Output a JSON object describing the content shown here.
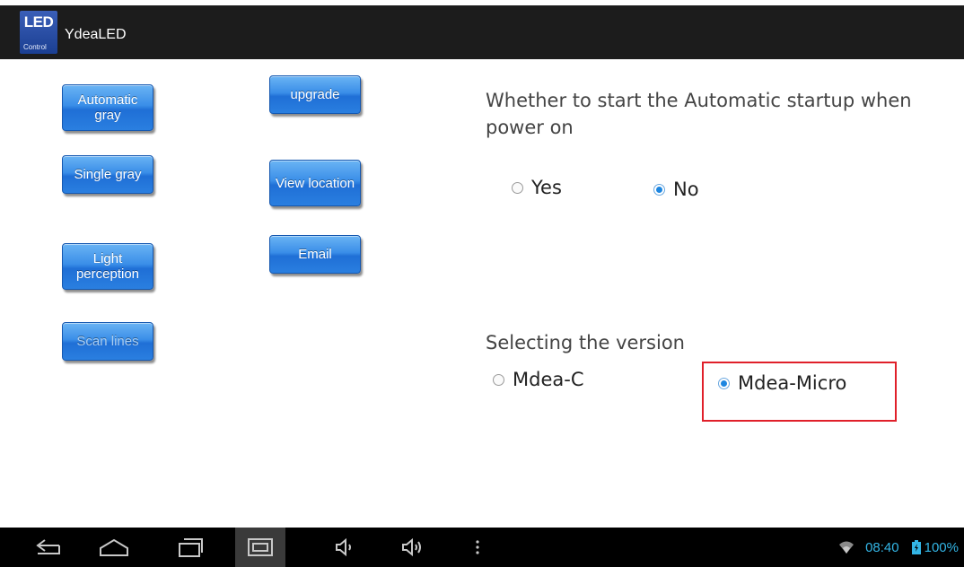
{
  "app": {
    "icon_text_big": "LED",
    "icon_text_small": "Control",
    "title": "YdeaLED"
  },
  "buttons": {
    "automatic_gray": "Automatic gray",
    "upgrade": "upgrade",
    "single_gray": "Single gray",
    "view_location": "View location",
    "light_perception": "Light perception",
    "email": "Email",
    "scan_lines": "Scan lines"
  },
  "startup": {
    "question": "Whether to start the Automatic startup when power on",
    "options": [
      {
        "label": "Yes",
        "checked": false
      },
      {
        "label": "No",
        "checked": true
      }
    ]
  },
  "version": {
    "heading": "Selecting the version",
    "options": [
      {
        "label": "Mdea-C",
        "checked": false
      },
      {
        "label": "Mdea-Micro",
        "checked": true
      }
    ]
  },
  "statusbar": {
    "time": "08:40",
    "battery": "100%"
  },
  "colors": {
    "accent": "#33b5e5",
    "button_blue": "#2a7fe0",
    "highlight": "#e0202a"
  },
  "nav_icons": [
    "back-icon",
    "home-icon",
    "recent-apps-icon",
    "screenshot-icon",
    "volume-down-icon",
    "volume-up-icon",
    "more-icon"
  ]
}
